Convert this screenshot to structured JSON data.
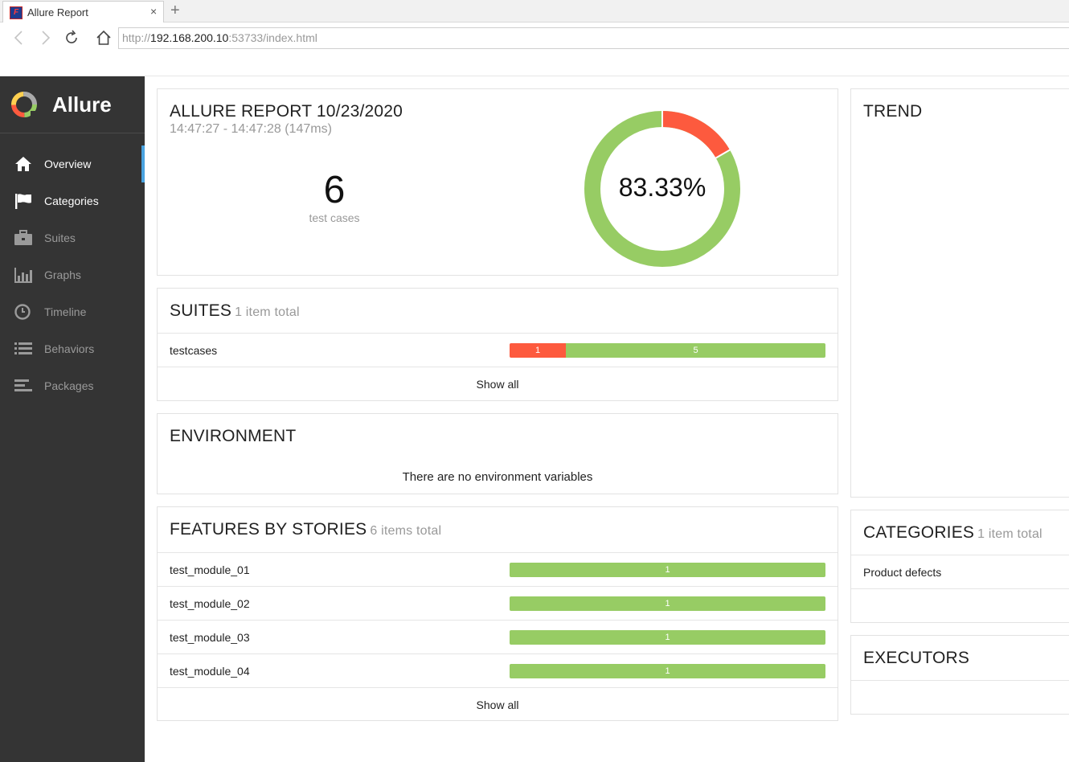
{
  "browser": {
    "tab_title": "Allure Report",
    "tab_close": "×",
    "new_tab": "+",
    "favicon_text": "F",
    "url_scheme": "http://",
    "url_host": "192.168.200.10",
    "url_rest": ":53733/index.html"
  },
  "sidebar": {
    "brand": "Allure",
    "items": [
      {
        "label": "Overview",
        "icon": "home-icon",
        "active": true
      },
      {
        "label": "Categories",
        "icon": "flag-icon"
      },
      {
        "label": "Suites",
        "icon": "briefcase-icon"
      },
      {
        "label": "Graphs",
        "icon": "bar-chart-icon"
      },
      {
        "label": "Timeline",
        "icon": "clock-icon"
      },
      {
        "label": "Behaviors",
        "icon": "list-icon"
      },
      {
        "label": "Packages",
        "icon": "align-left-icon"
      }
    ]
  },
  "summary": {
    "title": "ALLURE REPORT 10/23/2020",
    "date": "14:47:27 - 14:47:28 (147ms)",
    "count": "6",
    "count_label": "test cases",
    "percent": "83.33%",
    "passed_fraction": 0.8333
  },
  "suites": {
    "title": "SUITES",
    "subtitle": "1 item total",
    "rows": [
      {
        "name": "testcases",
        "failed": 1,
        "passed": 5
      }
    ],
    "show_all": "Show all"
  },
  "environment": {
    "title": "ENVIRONMENT",
    "empty_text": "There are no environment variables"
  },
  "features": {
    "title": "FEATURES BY STORIES",
    "subtitle": "6 items total",
    "rows": [
      {
        "name": "test_module_01",
        "passed": 1
      },
      {
        "name": "test_module_02",
        "passed": 1
      },
      {
        "name": "test_module_03",
        "passed": 1
      },
      {
        "name": "test_module_04",
        "passed": 1
      }
    ],
    "show_all": "Show all"
  },
  "trend": {
    "title": "TREND"
  },
  "categories": {
    "title": "CATEGORIES",
    "subtitle": "1 item total",
    "rows": [
      {
        "name": "Product defects"
      }
    ]
  },
  "executors": {
    "title": "EXECUTORS"
  },
  "colors": {
    "failed": "#fd5a3e",
    "passed": "#97cc64",
    "sidebar": "#343434",
    "accent": "#4aa3df"
  }
}
